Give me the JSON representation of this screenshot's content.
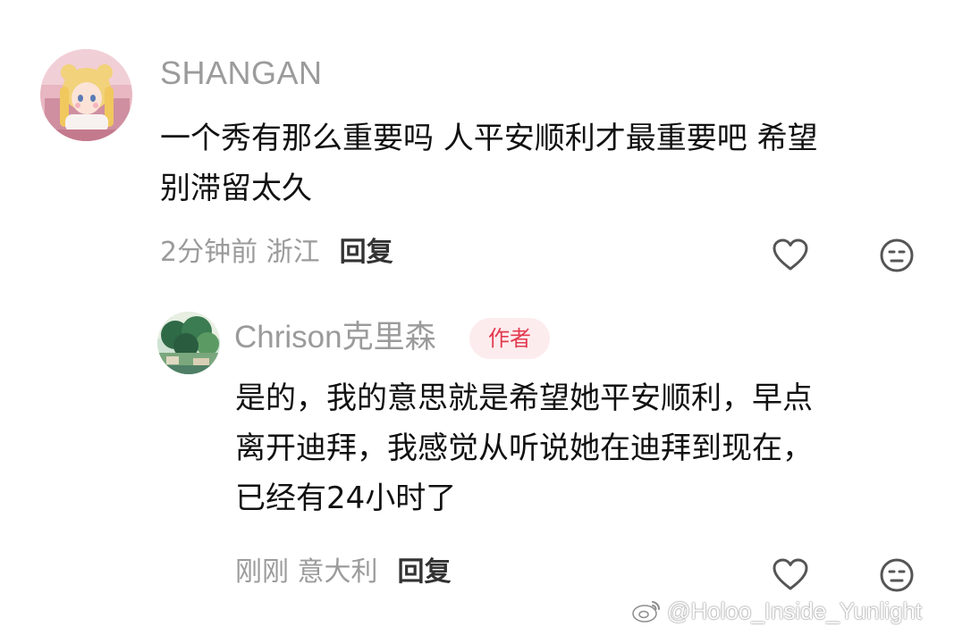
{
  "comments": [
    {
      "username": "SHANGAN",
      "avatar_icon": "anime-girl-avatar",
      "text_lines": [
        "一个秀有那么重要吗 人平安顺利才最重要吧 希望",
        "别滞留太久"
      ],
      "time_location": "2分钟前 浙江",
      "reply_label": "回复",
      "like_icon": "heart-outline-icon",
      "emoji_icon": "neutral-face-icon"
    },
    {
      "username": "Chrison克里森",
      "author_badge": "作者",
      "avatar_icon": "forest-landscape-avatar",
      "text_lines": [
        "是的，我的意思就是希望她平安顺利，早点",
        "离开迪拜，我感觉从听说她在迪拜到现在，",
        "已经有24小时了"
      ],
      "time_location": "刚刚 意大利",
      "reply_label": "回复",
      "like_icon": "heart-outline-icon",
      "emoji_icon": "neutral-face-icon"
    }
  ],
  "watermark": {
    "text": "@Holoo_Inside_Yunlight",
    "icon": "weibo-logo-icon"
  },
  "colors": {
    "username": "#9b9b9b",
    "body_text": "#111111",
    "meta_text": "#9b9b9b",
    "reply_text": "#333333",
    "badge_bg": "#fdecee",
    "badge_text": "#e33a4f",
    "icon_stroke": "#555555"
  }
}
